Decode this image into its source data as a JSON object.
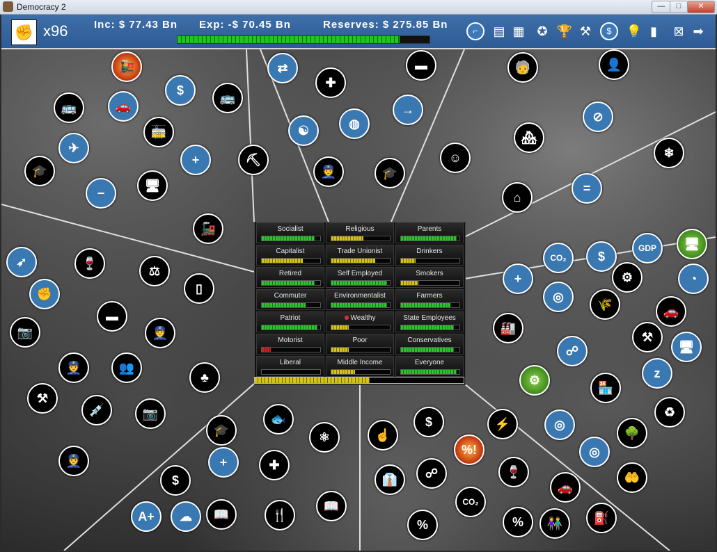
{
  "window": {
    "title": "Democracy 2",
    "min": "—",
    "max": "□",
    "close": "✕"
  },
  "topbar": {
    "turns": "x96",
    "income": "Inc: $ 77.43 Bn",
    "expenses": "Exp: -$ 70.45 Bn",
    "reserves": "Reserves: $ 275.85 Bn",
    "budget_progress": 0.88,
    "tools": [
      "gun-icon",
      "document-icon",
      "cabinet-icon",
      "award-icon",
      "trophy-icon",
      "tools-icon",
      "dollar-icon",
      "bulb-icon",
      "chart-icon",
      "options-icon",
      "next-turn-arrow-icon"
    ]
  },
  "voters": [
    {
      "name": "Socialist",
      "level": 0.9,
      "color": "green"
    },
    {
      "name": "Religious",
      "level": 0.55,
      "color": "yellow"
    },
    {
      "name": "Parents",
      "level": 0.95,
      "color": "green"
    },
    {
      "name": "Capitalist",
      "level": 0.7,
      "color": "yellow"
    },
    {
      "name": "Trade Unionist",
      "level": 0.75,
      "color": "yellow"
    },
    {
      "name": "Drinkers",
      "level": 0.25,
      "color": "yellow"
    },
    {
      "name": "Retired",
      "level": 0.9,
      "color": "green"
    },
    {
      "name": "Self Employed",
      "level": 0.95,
      "color": "green"
    },
    {
      "name": "Smokers",
      "level": 0.3,
      "color": "yellow"
    },
    {
      "name": "Commuter",
      "level": 0.75,
      "color": "green"
    },
    {
      "name": "Environmentalist",
      "level": 0.95,
      "color": "green"
    },
    {
      "name": "Farmers",
      "level": 0.85,
      "color": "green"
    },
    {
      "name": "Patriot",
      "level": 0.95,
      "color": "green"
    },
    {
      "name": "Wealthy",
      "level": 0.3,
      "color": "yellow"
    },
    {
      "name": "State Employees",
      "level": 0.9,
      "color": "green"
    },
    {
      "name": "Motorist",
      "level": 0.15,
      "color": "red"
    },
    {
      "name": "Poor",
      "level": 0.3,
      "color": "yellow"
    },
    {
      "name": "Conservatives",
      "level": 0.9,
      "color": "green"
    },
    {
      "name": "Liberal",
      "level": 0.0,
      "color": "green"
    },
    {
      "name": "Middle Income",
      "level": 0.4,
      "color": "yellow"
    },
    {
      "name": "Everyone",
      "level": 0.95,
      "color": "green"
    }
  ],
  "popularity": 0.55,
  "policies": [
    {
      "name": "fire-train-icon",
      "glyph": "🚂",
      "style": "red"
    },
    {
      "name": "water-tax-icon",
      "glyph": "$",
      "style": "blue"
    },
    {
      "name": "bus-icon",
      "glyph": "🚌",
      "style": ""
    },
    {
      "name": "bus-lane-icon",
      "glyph": "🚌",
      "style": ""
    },
    {
      "name": "car-icon",
      "glyph": "🚗",
      "style": "blue"
    },
    {
      "name": "tram-icon",
      "glyph": "🚋",
      "style": ""
    },
    {
      "name": "airplane-icon",
      "glyph": "✈",
      "style": "blue"
    },
    {
      "name": "school-bus-icon",
      "glyph": "🎓",
      "style": ""
    },
    {
      "name": "water-plus-icon",
      "glyph": "+",
      "style": "blue"
    },
    {
      "name": "water-minus-icon",
      "glyph": "−",
      "style": "blue"
    },
    {
      "name": "road-worker-icon",
      "glyph": "⛏",
      "style": ""
    },
    {
      "name": "telecommute-icon",
      "glyph": "🖥",
      "style": ""
    },
    {
      "name": "steam-train-icon",
      "glyph": "🚂",
      "style": ""
    },
    {
      "name": "ship-arrows-icon",
      "glyph": "⇄",
      "style": "blue"
    },
    {
      "name": "hospital-ship-icon",
      "glyph": "✚",
      "style": ""
    },
    {
      "name": "tank-icon",
      "glyph": "▬",
      "style": ""
    },
    {
      "name": "yin-yang-icon",
      "glyph": "☯",
      "style": "blue"
    },
    {
      "name": "globe-icon",
      "glyph": "◍",
      "style": "blue"
    },
    {
      "name": "immigration-icon",
      "glyph": "→",
      "style": "blue"
    },
    {
      "name": "police-officer-icon",
      "glyph": "👮",
      "style": ""
    },
    {
      "name": "graduation-flag-icon",
      "glyph": "🎓",
      "style": ""
    },
    {
      "name": "elderly-icon",
      "glyph": "🧓",
      "style": ""
    },
    {
      "name": "person-icon",
      "glyph": "👤",
      "style": ""
    },
    {
      "name": "no-money-icon",
      "glyph": "⊘",
      "style": "blue"
    },
    {
      "name": "housing-icon",
      "glyph": "🏘",
      "style": ""
    },
    {
      "name": "child-icon",
      "glyph": "☺",
      "style": ""
    },
    {
      "name": "winter-fuel-icon",
      "glyph": "❄",
      "style": ""
    },
    {
      "name": "home-icon",
      "glyph": "⌂",
      "style": ""
    },
    {
      "name": "equality-icon",
      "glyph": "=",
      "style": "blue"
    },
    {
      "name": "equipment-icon",
      "glyph": "➶",
      "style": "blue"
    },
    {
      "name": "alcohol-icon",
      "glyph": "🍷",
      "style": ""
    },
    {
      "name": "jury-icon",
      "glyph": "⚖",
      "style": ""
    },
    {
      "name": "handshake-icon",
      "glyph": "✊",
      "style": "blue"
    },
    {
      "name": "prison-door-icon",
      "glyph": "▯",
      "style": ""
    },
    {
      "name": "speed-camera-icon",
      "glyph": "📷",
      "style": ""
    },
    {
      "name": "handgun-icon",
      "glyph": "▬",
      "style": ""
    },
    {
      "name": "soldier-icon",
      "glyph": "👮",
      "style": ""
    },
    {
      "name": "guard-icon",
      "glyph": "👮",
      "style": ""
    },
    {
      "name": "crowd-police-icon",
      "glyph": "👥",
      "style": ""
    },
    {
      "name": "gambling-icon",
      "glyph": "♣",
      "style": ""
    },
    {
      "name": "gavel-icon",
      "glyph": "⚒",
      "style": ""
    },
    {
      "name": "syringe-icon",
      "glyph": "💉",
      "style": ""
    },
    {
      "name": "cctv-icon",
      "glyph": "📷",
      "style": ""
    },
    {
      "name": "officer-icon",
      "glyph": "👮",
      "style": ""
    },
    {
      "name": "co2-icon",
      "glyph": "CO₂",
      "style": "blue"
    },
    {
      "name": "wage-icon",
      "glyph": "$",
      "style": "blue"
    },
    {
      "name": "gdp-icon",
      "glyph": "GDP",
      "style": "blue"
    },
    {
      "name": "technology-icon",
      "glyph": "🖥",
      "style": "green"
    },
    {
      "name": "innovation-icon",
      "glyph": "+",
      "style": "blue"
    },
    {
      "name": "industry-aid-icon",
      "glyph": "⚙",
      "style": ""
    },
    {
      "name": "chart-pie-icon",
      "glyph": "◔",
      "style": "blue"
    },
    {
      "name": "coins-icon",
      "glyph": "◎",
      "style": "blue"
    },
    {
      "name": "agriculture-icon",
      "glyph": "🌾",
      "style": ""
    },
    {
      "name": "factory-icon",
      "glyph": "🏭",
      "style": ""
    },
    {
      "name": "traffic-icon",
      "glyph": "🚗",
      "style": ""
    },
    {
      "name": "organization-icon",
      "glyph": "☍",
      "style": "blue"
    },
    {
      "name": "tools-wrench-icon",
      "glyph": "⚒",
      "style": ""
    },
    {
      "name": "computer-icon",
      "glyph": "🖥",
      "style": "blue"
    },
    {
      "name": "gears-icon",
      "glyph": "⚙",
      "style": "green"
    },
    {
      "name": "sleep-icon",
      "glyph": "z",
      "style": "blue"
    },
    {
      "name": "shopkeeper-icon",
      "glyph": "🏪",
      "style": ""
    },
    {
      "name": "recycle-icon",
      "glyph": "♻",
      "style": ""
    },
    {
      "name": "coin-stack-icon",
      "glyph": "◎",
      "style": "blue"
    },
    {
      "name": "tree-icon",
      "glyph": "🌳",
      "style": ""
    },
    {
      "name": "coins-blue-icon",
      "glyph": "◎",
      "style": "blue"
    },
    {
      "name": "charity-icon",
      "glyph": "🤲",
      "style": ""
    },
    {
      "name": "fish-icon",
      "glyph": "🐟",
      "style": ""
    },
    {
      "name": "education-hand-icon",
      "glyph": "🎓",
      "style": ""
    },
    {
      "name": "atom-icon",
      "glyph": "⚛",
      "style": ""
    },
    {
      "name": "health-plus-icon",
      "glyph": "+",
      "style": "blue"
    },
    {
      "name": "hospital-cross-icon",
      "glyph": "✚",
      "style": ""
    },
    {
      "name": "graduate-money-icon",
      "glyph": "$",
      "style": ""
    },
    {
      "name": "library-icon",
      "glyph": "📖",
      "style": ""
    },
    {
      "name": "grade-a-icon",
      "glyph": "A+",
      "style": "blue"
    },
    {
      "name": "cloud-icon",
      "glyph": "☁",
      "style": "blue"
    },
    {
      "name": "book-icon",
      "glyph": "📖",
      "style": ""
    },
    {
      "name": "food-icon",
      "glyph": "🍴",
      "style": ""
    },
    {
      "name": "hand-point-icon",
      "glyph": "☝",
      "style": ""
    },
    {
      "name": "property-tax-icon",
      "glyph": "$",
      "style": ""
    },
    {
      "name": "electric-car-icon",
      "glyph": "⚡",
      "style": ""
    },
    {
      "name": "income-tax-icon",
      "glyph": "%!",
      "style": "red"
    },
    {
      "name": "family-tree-icon",
      "glyph": "☍",
      "style": ""
    },
    {
      "name": "wine-bottle-icon",
      "glyph": "🍷",
      "style": ""
    },
    {
      "name": "businessman-icon",
      "glyph": "👔",
      "style": ""
    },
    {
      "name": "co2-tax-icon",
      "glyph": "CO₂",
      "style": ""
    },
    {
      "name": "car-tax-icon",
      "glyph": "🚗",
      "style": ""
    },
    {
      "name": "shopping-tax-icon",
      "glyph": "%",
      "style": ""
    },
    {
      "name": "couple-icon",
      "glyph": "👫",
      "style": ""
    },
    {
      "name": "percent-icon",
      "glyph": "%",
      "style": ""
    },
    {
      "name": "petrol-icon",
      "glyph": "⛽",
      "style": ""
    }
  ]
}
